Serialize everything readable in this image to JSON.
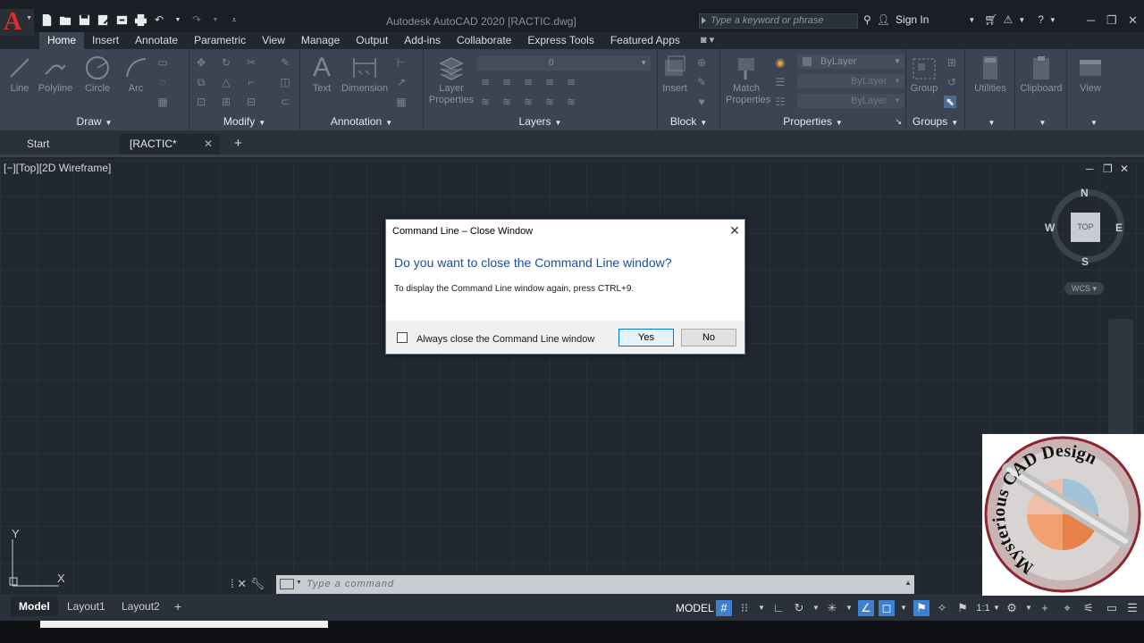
{
  "titlebar": {
    "title": "Autodesk AutoCAD 2020    [RACTIC.dwg]",
    "search_placeholder": "Type a keyword or phrase",
    "sign_in": "Sign In",
    "app_logo_letter": "A"
  },
  "ribbon_tabs": [
    "Home",
    "Insert",
    "Annotate",
    "Parametric",
    "View",
    "Manage",
    "Output",
    "Add-ins",
    "Collaborate",
    "Express Tools",
    "Featured Apps"
  ],
  "ribbon": {
    "draw": {
      "title": "Draw",
      "tools": [
        "Line",
        "Polyline",
        "Circle",
        "Arc"
      ]
    },
    "modify": {
      "title": "Modify"
    },
    "annotation": {
      "title": "Annotation",
      "tools": [
        "Text",
        "Dimension"
      ]
    },
    "layers": {
      "title": "Layers",
      "layer_properties": [
        "Layer",
        "Properties"
      ],
      "current_layer": "0"
    },
    "block": {
      "title": "Block",
      "insert": "Insert"
    },
    "properties": {
      "title": "Properties",
      "match": [
        "Match",
        "Properties"
      ],
      "color": "ByLayer",
      "linetype": "ByLayer",
      "lineweight": "ByLayer"
    },
    "groups": {
      "title": "Groups",
      "group": "Group"
    },
    "utilities": "Utilities",
    "clipboard": "Clipboard",
    "view": "View"
  },
  "doc_tabs": {
    "start": "Start",
    "active": "[RACTIC*"
  },
  "viewport": {
    "label": "[−][Top][2D Wireframe]"
  },
  "viewcube": {
    "top": "TOP",
    "n": "N",
    "s": "S",
    "e": "E",
    "w": "W",
    "wcs": "WCS"
  },
  "ucs": {
    "x": "X",
    "y": "Y"
  },
  "dialog": {
    "title": "Command Line – Close Window",
    "heading": "Do you want to close the Command Line window?",
    "body": "To display the Command Line window again, press CTRL+9.",
    "checkbox_label": "Always close the Command Line window",
    "yes": "Yes",
    "no": "No"
  },
  "command_line": {
    "placeholder": "Type a command"
  },
  "status": {
    "layout_tabs": [
      "Model",
      "Layout1",
      "Layout2"
    ],
    "model": "MODEL",
    "scale": "1:1"
  },
  "watermark": {
    "text": "Mysterious CAD Design"
  },
  "colors": {
    "accent": "#3f7fd1",
    "dialog_heading": "#1d4e9c",
    "logo_red": "#e02b2b",
    "canvas": "#212830"
  }
}
